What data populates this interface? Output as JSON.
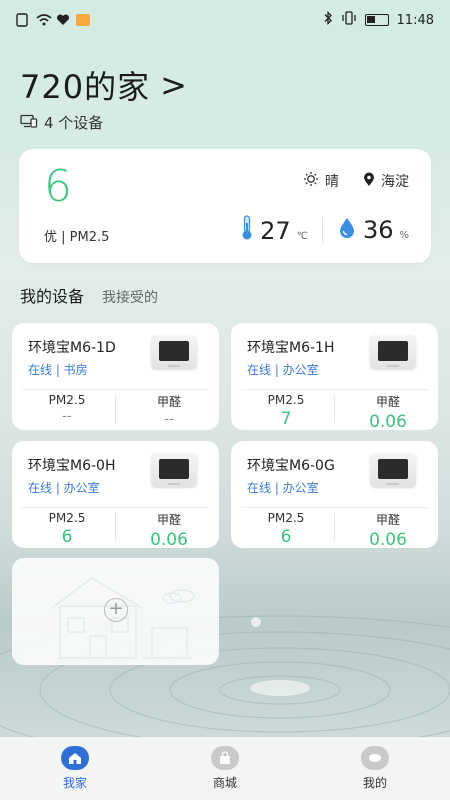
{
  "status_bar": {
    "time": "11:48"
  },
  "home": {
    "name": "720的家",
    "chevron": ">",
    "device_count": "4 个设备"
  },
  "air_card": {
    "aqi": "6",
    "aqi_label": "优 | PM2.5",
    "weather": "晴",
    "location": "海淀",
    "temperature": "27",
    "temperature_unit": "℃",
    "humidity": "36",
    "humidity_unit": "%",
    "accent_color": "#3cc27a"
  },
  "tabs": {
    "active": "我的设备",
    "other": "我接受的"
  },
  "devices": [
    {
      "name": "环境宝M6-1D",
      "status": "在线 | 书房",
      "pm25_label": "PM2.5",
      "pm25": "--",
      "hcho_label": "甲醛",
      "hcho": "--"
    },
    {
      "name": "环境宝M6-1H",
      "status": "在线 | 办公室",
      "pm25_label": "PM2.5",
      "pm25": "7",
      "hcho_label": "甲醛",
      "hcho": "0.06"
    },
    {
      "name": "环境宝M6-0H",
      "status": "在线 | 办公室",
      "pm25_label": "PM2.5",
      "pm25": "6",
      "hcho_label": "甲醛",
      "hcho": "0.06"
    },
    {
      "name": "环境宝M6-0G",
      "status": "在线 | 办公室",
      "pm25_label": "PM2.5",
      "pm25": "6",
      "hcho_label": "甲醛",
      "hcho": "0.06"
    }
  ],
  "add_card": {
    "icon": "plus-icon"
  },
  "bottom_nav": [
    {
      "label": "我家",
      "icon": "home-icon",
      "active": true
    },
    {
      "label": "商城",
      "icon": "shop-icon",
      "active": false
    },
    {
      "label": "我的",
      "icon": "profile-icon",
      "active": false
    }
  ]
}
